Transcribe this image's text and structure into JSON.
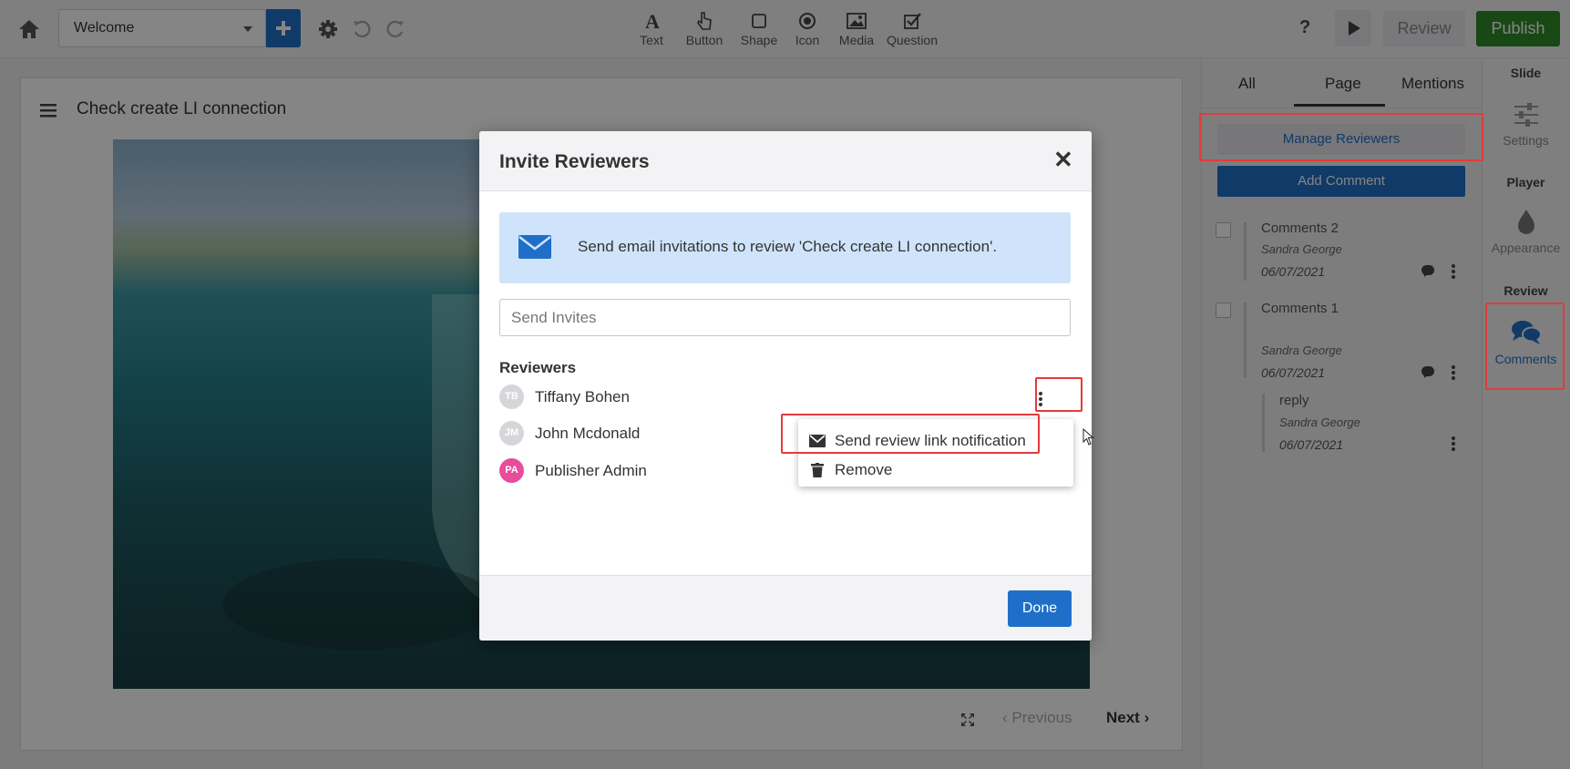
{
  "toolbar": {
    "slide_select_value": "Welcome",
    "tools": [
      {
        "label": "Text",
        "icon": "text-icon"
      },
      {
        "label": "Button",
        "icon": "pointer-icon"
      },
      {
        "label": "Shape",
        "icon": "shape-icon"
      },
      {
        "label": "Icon",
        "icon": "icon-icon"
      },
      {
        "label": "Media",
        "icon": "image-icon"
      },
      {
        "label": "Question",
        "icon": "checkbox-icon"
      }
    ],
    "help_label": "?",
    "review_label": "Review",
    "publish_label": "Publish"
  },
  "slide": {
    "title": "Check create LI connection",
    "prev_label": "Previous",
    "next_label": "Next"
  },
  "panel": {
    "tabs": [
      {
        "label": "All"
      },
      {
        "label": "Page"
      },
      {
        "label": "Mentions"
      }
    ],
    "active_tab": "Page",
    "manage_reviewers_label": "Manage Reviewers",
    "add_comment_label": "Add Comment",
    "comments": [
      {
        "title": "Comments 2",
        "author": "Sandra George",
        "date": "06/07/2021"
      },
      {
        "title": "Comments 1",
        "author": "Sandra George",
        "date": "06/07/2021"
      }
    ],
    "reply": {
      "title": "reply",
      "author": "Sandra George",
      "date": "06/07/2021"
    }
  },
  "rail": {
    "slide_heading": "Slide",
    "settings_label": "Settings",
    "player_heading": "Player",
    "appearance_label": "Appearance",
    "review_heading": "Review",
    "comments_label": "Comments"
  },
  "modal": {
    "title": "Invite Reviewers",
    "close_glyph": "✕",
    "info_text": "Send email invitations to review 'Check create LI connection'.",
    "invite_placeholder": "Send Invites",
    "reviewers_heading": "Reviewers",
    "reviewers": [
      {
        "initials": "TB",
        "name": "Tiffany Bohen"
      },
      {
        "initials": "JM",
        "name": "John Mcdonald"
      },
      {
        "initials": "PA",
        "name": "Publisher Admin"
      }
    ],
    "menu": {
      "send_label": "Send review link notification",
      "remove_label": "Remove"
    },
    "done_label": "Done"
  },
  "colors": {
    "accent": "#1f6fc8",
    "publish": "#2e8b28",
    "highlight": "#e23b3b",
    "info_bg": "#cfe4fb",
    "avatar_pa": "#e84c9c"
  }
}
